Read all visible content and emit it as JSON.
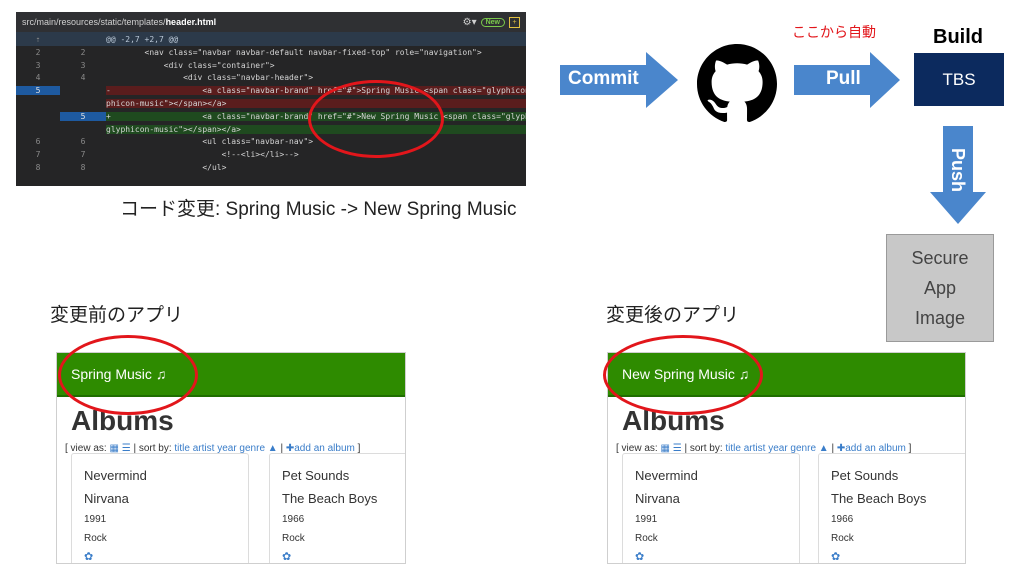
{
  "diff": {
    "file_path": "src/main/resources/static/templates/",
    "file_name": "header.html",
    "gear_icon": "gear-icon",
    "new_badge": "New",
    "expand_glyph": "⇡",
    "hunk": "@@ -2,7 +2,7 @@",
    "lines": [
      {
        "old": "2",
        "new": "2",
        "type": "ctx",
        "code": "        <nav class=\"navbar navbar-default navbar-fixed-top\" role=\"navigation\">"
      },
      {
        "old": "3",
        "new": "3",
        "type": "ctx",
        "code": "            <div class=\"container\">"
      },
      {
        "old": "4",
        "new": "4",
        "type": "ctx",
        "code": "                <div class=\"navbar-header\">"
      },
      {
        "old": "5",
        "new": "",
        "type": "del",
        "code": "-                   <a class=\"navbar-brand\" href=\"#\">Spring Music <span class=\"glyphicon gly"
      },
      {
        "old": "",
        "new": "",
        "type": "del",
        "code": "phicon-music\"></span></a>"
      },
      {
        "old": "",
        "new": "5",
        "type": "add",
        "code": "+                   <a class=\"navbar-brand\" href=\"#\">New Spring Music <span class=\"glyphicon"
      },
      {
        "old": "",
        "new": "",
        "type": "add",
        "code": "glyphicon-music\"></span></a>"
      },
      {
        "old": "6",
        "new": "6",
        "type": "ctx",
        "code": "                    <ul class=\"navbar-nav\">"
      },
      {
        "old": "7",
        "new": "7",
        "type": "ctx",
        "code": "                        <!--<li></li>-->"
      },
      {
        "old": "8",
        "new": "8",
        "type": "ctx",
        "code": "                    </ul>"
      }
    ]
  },
  "caption_code": "コード変更: Spring Music -> New Spring Music",
  "flow": {
    "commit_label": "Commit",
    "pull_label": "Pull",
    "push_label": "Push",
    "auto_label": "ここから自動",
    "build_label": "Build",
    "tbs_label": "TBS",
    "github_icon": "github-octocat-icon",
    "secure_lines": [
      "Secure",
      "App",
      "Image"
    ]
  },
  "colors": {
    "arrow_blue": "#4a86cc",
    "tbs_navy": "#0c2a5e",
    "auto_red": "#e2161b",
    "secure_gray": "#c8c8c8",
    "nav_green": "#2e8b00"
  },
  "apps": {
    "before_caption": "変更前のアプリ",
    "after_caption": "変更後のアプリ",
    "before": {
      "brand": "Spring Music",
      "music_icon": "♫",
      "title": "Albums",
      "view_as": "[ view as:",
      "sort_by": "| sort by:",
      "sort_links": "title artist year genre",
      "add_album": "add an album",
      "end": "]",
      "albums": [
        {
          "title": "Nevermind",
          "artist": "Nirvana",
          "year": "1991",
          "genre": "Rock"
        },
        {
          "title": "Pet Sounds",
          "artist": "The Beach Boys",
          "year": "1966",
          "genre": "Rock"
        }
      ]
    },
    "after": {
      "brand": "New Spring Music",
      "music_icon": "♫",
      "title": "Albums",
      "view_as": "[ view as:",
      "sort_by": "| sort by:",
      "sort_links": "title artist year genre",
      "add_album": "add an album",
      "end": "]",
      "albums": [
        {
          "title": "Nevermind",
          "artist": "Nirvana",
          "year": "1991",
          "genre": "Rock"
        },
        {
          "title": "Pet Sounds",
          "artist": "The Beach Boys",
          "year": "1966",
          "genre": "Rock"
        }
      ]
    }
  }
}
